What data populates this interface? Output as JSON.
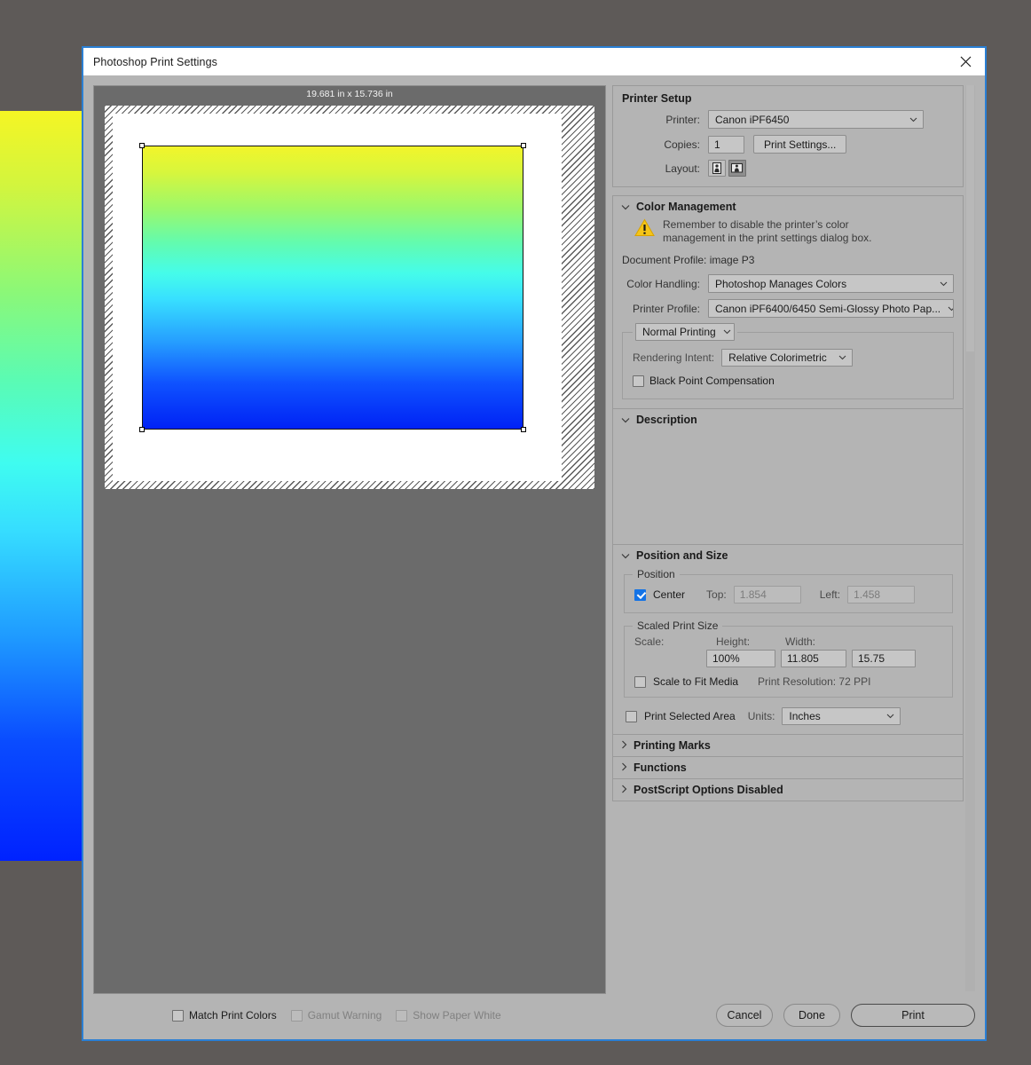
{
  "window": {
    "title": "Photoshop Print Settings",
    "close_icon": "close-icon"
  },
  "preview": {
    "size_label": "19.681 in x 15.736 in",
    "options": [
      {
        "label": "Match Print Colors",
        "checked": false,
        "disabled": false
      },
      {
        "label": "Gamut Warning",
        "checked": false,
        "disabled": true
      },
      {
        "label": "Show Paper White",
        "checked": false,
        "disabled": true
      }
    ]
  },
  "printer_setup": {
    "title": "Printer Setup",
    "printer_label": "Printer:",
    "printer_value": "Canon iPF6450",
    "copies_label": "Copies:",
    "copies_value": "1",
    "print_settings_button": "Print Settings...",
    "layout_label": "Layout:",
    "layout_portrait_icon": "orientation-portrait-icon",
    "layout_landscape_icon": "orientation-landscape-icon",
    "layout_selected": "landscape"
  },
  "color_management": {
    "title": "Color Management",
    "warning_icon": "warning-triangle-icon",
    "warning_text": "Remember to disable the printer’s color management in the print settings dialog box.",
    "document_profile": "Document Profile: image P3",
    "color_handling_label": "Color Handling:",
    "color_handling_value": "Photoshop Manages Colors",
    "printer_profile_label": "Printer Profile:",
    "printer_profile_value": "Canon iPF6400/6450 Semi-Glossy Photo Pap...",
    "print_mode_value": "Normal Printing",
    "rendering_intent_label": "Rendering Intent:",
    "rendering_intent_value": "Relative Colorimetric",
    "black_point_label": "Black Point Compensation",
    "black_point_checked": false
  },
  "description": {
    "title": "Description",
    "text": ""
  },
  "position_and_size": {
    "title": "Position and Size",
    "position_group_label": "Position",
    "center_label": "Center",
    "center_checked": true,
    "top_label": "Top:",
    "top_value": "1.854",
    "left_label": "Left:",
    "left_value": "1.458",
    "scaled_group_label": "Scaled Print Size",
    "scale_label": "Scale:",
    "scale_value": "100%",
    "height_label": "Height:",
    "height_value": "11.805",
    "width_label": "Width:",
    "width_value": "15.75",
    "scale_to_fit_label": "Scale to Fit Media",
    "scale_to_fit_checked": false,
    "print_resolution": "Print Resolution: 72 PPI",
    "print_selected_area_label": "Print Selected Area",
    "print_selected_area_checked": false,
    "units_label": "Units:",
    "units_value": "Inches"
  },
  "collapsed_sections": [
    {
      "title": "Printing Marks"
    },
    {
      "title": "Functions"
    },
    {
      "title": "PostScript Options Disabled"
    }
  ],
  "buttons": {
    "cancel": "Cancel",
    "done": "Done",
    "print": "Print"
  },
  "colors": {
    "accent": "#2a7fd4",
    "checkbox_checked": "#1473e6",
    "warning": "#f5c518",
    "panel": "#b4b4b4",
    "preview_bg": "#6b6b6b"
  }
}
